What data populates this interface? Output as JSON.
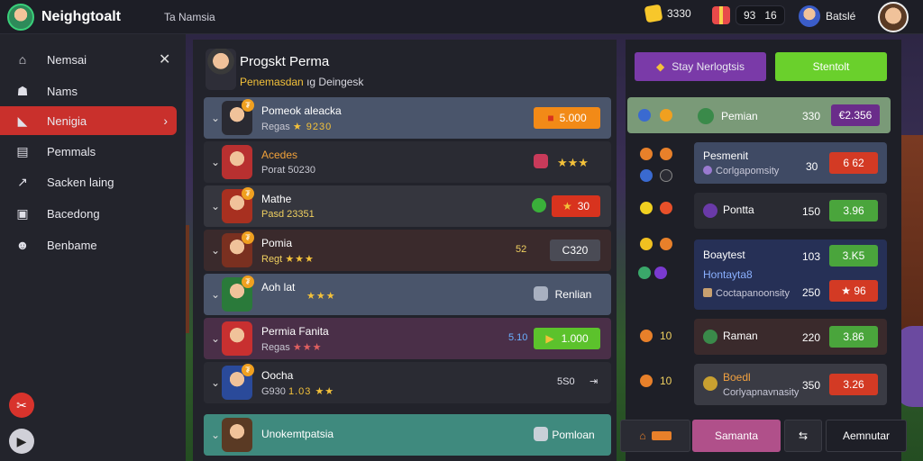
{
  "topbar": {
    "brand": "Neighgtoalt",
    "subtitle": "Ta Namsia",
    "coins": "3330",
    "gifts": "93",
    "gifts2": "16",
    "user": "Batslé"
  },
  "sidebar": {
    "items": [
      {
        "label": "Nemsai",
        "icon": "home-icon"
      },
      {
        "label": "Nams",
        "icon": "people-icon"
      },
      {
        "label": "Nenigia",
        "icon": "flag-icon"
      },
      {
        "label": "Pemmals",
        "icon": "store-icon"
      },
      {
        "label": "Sacken laing",
        "icon": "chart-icon"
      },
      {
        "label": "Bacedong",
        "icon": "bag-icon"
      },
      {
        "label": "Benbame",
        "icon": "friends-icon"
      }
    ],
    "active_index": 2
  },
  "main": {
    "title": "Progskt Perma",
    "sub_highlight": "Penemasdan",
    "sub_rest": "ıg Deingesk",
    "rows": [
      {
        "name": "Pomeok aleacka",
        "sub": "Regas",
        "stars": "★ 9230",
        "badge": "₮",
        "button": "5.000",
        "btn_color": "#f28a17",
        "bg": "#4a556b"
      },
      {
        "name": "Acedes",
        "sub": "Porat 50230",
        "stars": "",
        "badge": "",
        "button": "",
        "extra": "★★★",
        "bg": "#2a2b33"
      },
      {
        "name": "Mathe",
        "sub": "Pasd 23351",
        "stars": "",
        "badge": "₮",
        "button": "30",
        "btn_color": "#d8331e",
        "bg": "#35363e"
      },
      {
        "name": "Pomia",
        "sub": "Regt",
        "stars": "★★★",
        "badge": "₮",
        "num": "52",
        "button": "C320",
        "btn_color": "#4a4b55",
        "bg": "#3a2a2c"
      },
      {
        "name": "Aoh lat",
        "sub": "",
        "stars": "★★★",
        "badge": "₮",
        "button": "Renlian",
        "btn_color": "transparent",
        "bg": "#4a556b"
      },
      {
        "name": "Permia Fanita",
        "sub": "Regas",
        "stars": "★★★",
        "badge": "",
        "num": "5.10",
        "button": "1.000",
        "btn_color": "#5cc22c",
        "bg": "#4a2f48"
      },
      {
        "name": "Oocha",
        "sub": "G930",
        "stars": "1.03 ★★",
        "badge": "₮",
        "num": "5S0",
        "button": "",
        "bg": "#2a2b33"
      },
      {
        "name": "Unokemtpatsia",
        "sub": "",
        "stars": "",
        "badge": "",
        "button": "Pomloan",
        "btn_color": "transparent",
        "bg": "#3f8a7e"
      }
    ]
  },
  "right": {
    "btn_purple": "Stay Nerlogtsis",
    "btn_green": "Stentolt",
    "rows": [
      {
        "name": "Pemian",
        "val": "330",
        "btn": "€2.356",
        "btn_color": "#6a2c8a"
      },
      {
        "name": "Pesmenit",
        "sub": "Corlgapomsity",
        "val": "30",
        "btn": "6 62",
        "btn_color": "#d33a24"
      },
      {
        "name": "Pontta",
        "val": "150",
        "btn": "3.96",
        "btn_color": "#4aa53c"
      },
      {
        "name": "Boaytest",
        "val": "103",
        "btn": "3.K5",
        "btn_color": "#4aa53c"
      },
      {
        "name": "Hontayta8",
        "sub": "Coctapanoonsity",
        "val": "250",
        "btn": "★ 96",
        "btn_color": "#d33a24"
      },
      {
        "name": "Raman",
        "val": "220",
        "btn": "3.86",
        "btn_color": "#4aa53c"
      },
      {
        "name": "Boedl",
        "sub": "Corlyapnavnasity",
        "val": "350",
        "btn": "3.26",
        "btn_color": "#d33a24"
      }
    ],
    "side_nums": [
      "10",
      "10"
    ],
    "foot_pink": "Samanta",
    "foot_dark": "Aemnutar"
  }
}
